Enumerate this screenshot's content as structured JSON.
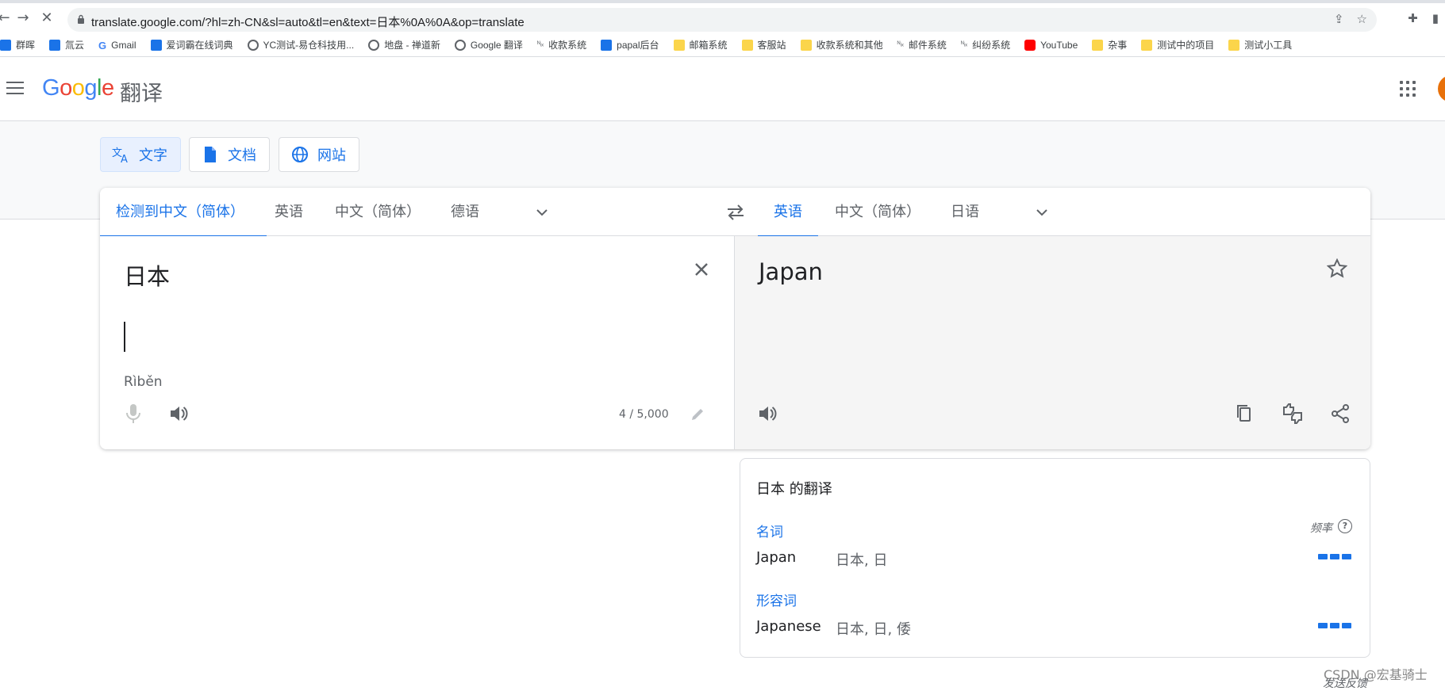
{
  "browser": {
    "url": "translate.google.com/?hl=zh-CN&sl=auto&tl=en&text=日本%0A%0A&op=translate",
    "bookmarks": [
      {
        "label": "群晖",
        "icon": "blue"
      },
      {
        "label": "氚云",
        "icon": "blue"
      },
      {
        "label": "Gmail",
        "icon": "g"
      },
      {
        "label": "爱词霸在线词典",
        "icon": "blue"
      },
      {
        "label": "YC测试-易仓科技用...",
        "icon": "globe"
      },
      {
        "label": "地盘 - 禅道新",
        "icon": "globe"
      },
      {
        "label": "Google 翻译",
        "icon": "globe"
      },
      {
        "label": "收款系统",
        "icon": "txt"
      },
      {
        "label": "papal后台",
        "icon": "blue"
      },
      {
        "label": "邮箱系统",
        "icon": "folder"
      },
      {
        "label": "客服站",
        "icon": "folder"
      },
      {
        "label": "收款系统和其他",
        "icon": "folder"
      },
      {
        "label": "邮件系统",
        "icon": "txt"
      },
      {
        "label": "纠纷系统",
        "icon": "txt"
      },
      {
        "label": "YouTube",
        "icon": "yt"
      },
      {
        "label": "杂事",
        "icon": "folder"
      },
      {
        "label": "测试中的项目",
        "icon": "folder"
      },
      {
        "label": "测试小工具",
        "icon": "folder"
      }
    ]
  },
  "header": {
    "logo": "Google",
    "product": "翻译"
  },
  "modes": [
    {
      "label": "文字"
    },
    {
      "label": "文档"
    },
    {
      "label": "网站"
    }
  ],
  "source_langs": [
    "检测到中文（简体）",
    "英语",
    "中文（简体）",
    "德语"
  ],
  "target_langs": [
    "英语",
    "中文（简体）",
    "日语"
  ],
  "source": {
    "text": "日本",
    "romanization": "Rìběn",
    "char_count": "4 / 5,000"
  },
  "target": {
    "text": "Japan"
  },
  "dictionary": {
    "title": "日本 的翻译",
    "frequency_label": "频率",
    "help": "?",
    "entries": [
      {
        "pos": "名词",
        "word": "Japan",
        "synonyms": "日本, 日",
        "frequency": 3
      },
      {
        "pos": "形容词",
        "word": "Japanese",
        "synonyms": "日本, 日, 倭",
        "frequency": 3
      }
    ]
  },
  "watermark": "CSDN @宏基骑士",
  "feedback": "发送反馈",
  "colors": {
    "accent": "#1a73e8",
    "target_bg": "#f5f5f5"
  }
}
